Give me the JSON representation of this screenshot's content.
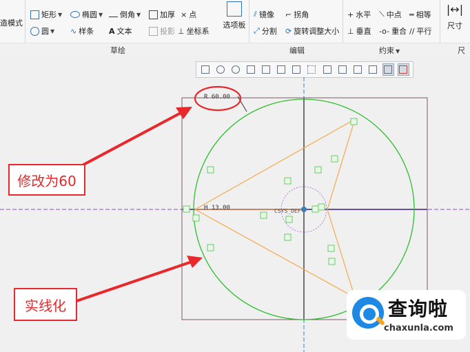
{
  "ribbon": {
    "groups": {
      "sketch": "草绘",
      "edit": "编辑",
      "constraint": "约束",
      "dimension": "尺寸"
    },
    "sketch_tools": {
      "rectangle": "矩形",
      "ellipse": "椭圆",
      "chamfer": "倒角",
      "thicken": "加厚",
      "point": "点",
      "circle": "圆",
      "spline": "样条",
      "text": "文本",
      "projection": "投影",
      "coordinate_system": "坐标系",
      "mode_partial": "造模式",
      "palette": "选项板"
    },
    "edit_tools": {
      "mirror": "镜像",
      "corner": "拐角",
      "divide": "分割",
      "rotate_resize": "旋转调整大小"
    },
    "constraint_tools": {
      "horizontal": "水平",
      "midpoint": "中点",
      "equal": "相等",
      "perpendicular": "垂直",
      "coincident": "重合",
      "parallel": "平行"
    },
    "dimension_tool": "尺寸"
  },
  "canvas": {
    "dim_radius": "R 60.00",
    "dim_offset": "H 13.00",
    "csys_label": "CSYS_DEF"
  },
  "callouts": {
    "change_to_60": "修改为60",
    "make_solid": "实线化"
  },
  "logo": {
    "main": "查询啦",
    "sub": "chaxunla.com"
  },
  "colors": {
    "circle": "#2cbf2c",
    "triangle_lines": "#f5a94a",
    "centerline": "#8c4fd1",
    "callout": "#e8282b",
    "constraint_marker": "#66cc66"
  }
}
